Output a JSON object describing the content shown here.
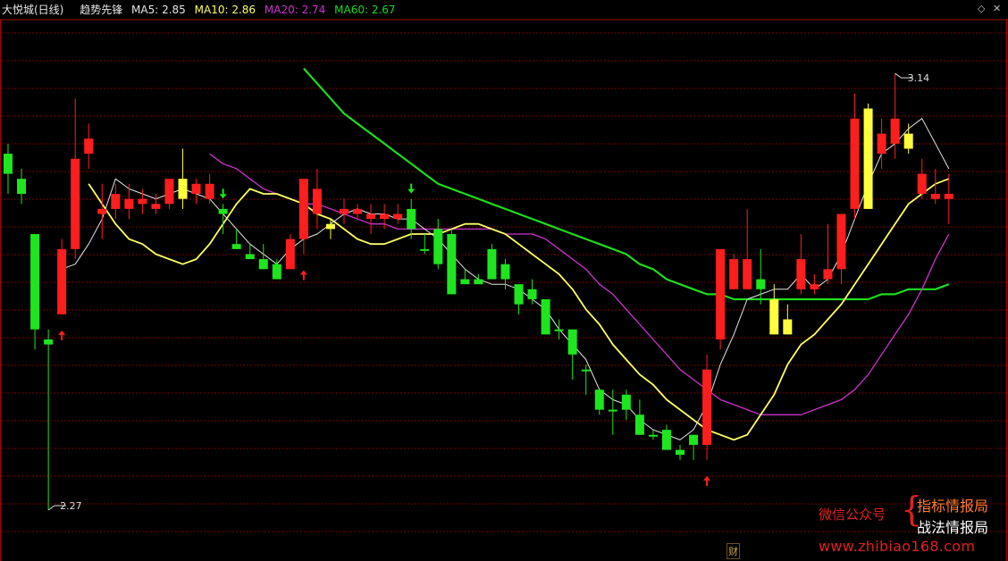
{
  "header": {
    "title": "大悦城(日线)",
    "indicator": "趋势先锋",
    "ma5": "MA5: 2.85",
    "ma10": "MA10: 2.86",
    "ma20": "MA20: 2.74",
    "ma60": "MA60: 2.67"
  },
  "controls": {
    "settings_icon": "diamond-icon",
    "close_icon": "close-icon"
  },
  "watermark": {
    "left": "微信公众号",
    "right_top": "指标情报局",
    "right_bottom": "战法情报局",
    "url": "www.zhibiao168.com"
  },
  "footer_badge": "财",
  "colors": {
    "up": "#ff1e1e",
    "down": "#1ee61e",
    "special": "#ffff3c",
    "ma5": "#e6e6e6",
    "ma10": "#ffff66",
    "ma20": "#cc33cc",
    "ma60": "#1edc1e",
    "grid": "#7a0000"
  },
  "chart_data": {
    "type": "candlestick",
    "title": "大悦城(日线)",
    "ylim": [
      2.222,
      3.272
    ],
    "annotations": {
      "high_label": "3.14",
      "low_label": "2.27"
    },
    "candles": [
      [
        2.98,
        2.94,
        3.0,
        2.9,
        "down"
      ],
      [
        2.93,
        2.9,
        2.95,
        2.88,
        "down"
      ],
      [
        2.82,
        2.63,
        2.82,
        2.59,
        "down"
      ],
      [
        2.61,
        2.6,
        2.63,
        2.27,
        "down"
      ],
      [
        2.66,
        2.79,
        2.81,
        2.66,
        "up"
      ],
      [
        2.79,
        2.97,
        3.09,
        2.77,
        "up"
      ],
      [
        2.98,
        3.01,
        3.04,
        2.95,
        "up"
      ],
      [
        2.87,
        2.86,
        2.92,
        2.81,
        "up"
      ],
      [
        2.87,
        2.9,
        2.92,
        2.85,
        "up"
      ],
      [
        2.87,
        2.89,
        2.92,
        2.85,
        "up"
      ],
      [
        2.88,
        2.89,
        2.91,
        2.86,
        "up"
      ],
      [
        2.88,
        2.87,
        2.9,
        2.86,
        "up"
      ],
      [
        2.88,
        2.93,
        2.93,
        2.87,
        "up"
      ],
      [
        2.89,
        2.93,
        2.99,
        2.87,
        "special"
      ],
      [
        2.9,
        2.92,
        2.93,
        2.88,
        "up"
      ],
      [
        2.89,
        2.92,
        2.94,
        2.88,
        "up"
      ],
      [
        2.86,
        2.87,
        2.88,
        2.82,
        "down"
      ],
      [
        2.8,
        2.79,
        2.83,
        2.79,
        "down"
      ],
      [
        2.78,
        2.77,
        2.8,
        2.77,
        "down"
      ],
      [
        2.77,
        2.75,
        2.8,
        2.75,
        "down"
      ],
      [
        2.76,
        2.73,
        2.77,
        2.73,
        "down"
      ],
      [
        2.75,
        2.81,
        2.82,
        2.75,
        "up"
      ],
      [
        2.81,
        2.93,
        2.93,
        2.78,
        "up"
      ],
      [
        2.86,
        2.91,
        2.95,
        2.83,
        "up"
      ],
      [
        2.83,
        2.84,
        2.85,
        2.81,
        "special"
      ],
      [
        2.86,
        2.87,
        2.89,
        2.84,
        "up"
      ],
      [
        2.87,
        2.86,
        2.88,
        2.85,
        "up"
      ],
      [
        2.85,
        2.86,
        2.88,
        2.82,
        "up"
      ],
      [
        2.85,
        2.86,
        2.88,
        2.83,
        "up"
      ],
      [
        2.86,
        2.85,
        2.88,
        2.84,
        "up"
      ],
      [
        2.87,
        2.83,
        2.89,
        2.81,
        "down"
      ],
      [
        2.79,
        2.79,
        2.82,
        2.78,
        "down"
      ],
      [
        2.83,
        2.76,
        2.85,
        2.75,
        "down"
      ],
      [
        2.82,
        2.7,
        2.83,
        2.7,
        "down"
      ],
      [
        2.73,
        2.72,
        2.75,
        2.72,
        "down"
      ],
      [
        2.73,
        2.72,
        2.74,
        2.72,
        "down"
      ],
      [
        2.79,
        2.73,
        2.8,
        2.73,
        "down"
      ],
      [
        2.76,
        2.73,
        2.77,
        2.71,
        "down"
      ],
      [
        2.72,
        2.68,
        2.72,
        2.66,
        "down"
      ],
      [
        2.71,
        2.69,
        2.73,
        2.68,
        "down"
      ],
      [
        2.69,
        2.62,
        2.69,
        2.62,
        "down"
      ],
      [
        2.63,
        2.63,
        2.65,
        2.61,
        "down"
      ],
      [
        2.63,
        2.58,
        2.63,
        2.53,
        "down"
      ],
      [
        2.55,
        2.55,
        2.56,
        2.5,
        "down"
      ],
      [
        2.51,
        2.47,
        2.51,
        2.46,
        "down"
      ],
      [
        2.47,
        2.47,
        2.51,
        2.42,
        "down"
      ],
      [
        2.5,
        2.47,
        2.51,
        2.45,
        "down"
      ],
      [
        2.46,
        2.42,
        2.49,
        2.42,
        "down"
      ],
      [
        2.42,
        2.42,
        2.43,
        2.41,
        "down"
      ],
      [
        2.43,
        2.39,
        2.44,
        2.39,
        "down"
      ],
      [
        2.39,
        2.38,
        2.4,
        2.37,
        "down"
      ],
      [
        2.42,
        2.4,
        2.42,
        2.37,
        "down"
      ],
      [
        2.4,
        2.55,
        2.58,
        2.37,
        "up"
      ],
      [
        2.61,
        2.79,
        2.79,
        2.59,
        "up"
      ],
      [
        2.71,
        2.77,
        2.78,
        2.71,
        "up"
      ],
      [
        2.71,
        2.77,
        2.87,
        2.71,
        "up"
      ],
      [
        2.73,
        2.71,
        2.79,
        2.68,
        "down"
      ],
      [
        2.69,
        2.62,
        2.72,
        2.62,
        "special"
      ],
      [
        2.62,
        2.65,
        2.68,
        2.62,
        "special"
      ],
      [
        2.71,
        2.77,
        2.82,
        2.7,
        "up"
      ],
      [
        2.71,
        2.72,
        2.74,
        2.7,
        "up"
      ],
      [
        2.73,
        2.75,
        2.84,
        2.72,
        "up"
      ],
      [
        2.75,
        2.86,
        2.86,
        2.72,
        "up"
      ],
      [
        2.87,
        3.05,
        3.1,
        2.85,
        "up"
      ],
      [
        2.87,
        3.07,
        3.08,
        2.87,
        "special"
      ],
      [
        2.98,
        3.02,
        3.05,
        2.95,
        "up"
      ],
      [
        3.0,
        3.05,
        3.14,
        2.97,
        "up"
      ],
      [
        3.02,
        2.99,
        3.04,
        2.98,
        "special"
      ],
      [
        2.94,
        2.9,
        2.97,
        2.89,
        "up"
      ],
      [
        2.89,
        2.9,
        2.95,
        2.88,
        "up"
      ],
      [
        2.89,
        2.9,
        2.94,
        2.84,
        "up"
      ]
    ],
    "ma5": [
      null,
      null,
      null,
      null,
      2.75,
      2.76,
      2.8,
      2.85,
      2.93,
      2.91,
      2.9,
      2.89,
      2.9,
      2.91,
      2.9,
      2.89,
      2.86,
      2.83,
      2.8,
      2.78,
      2.76,
      2.79,
      2.81,
      2.82,
      2.84,
      2.86,
      2.87,
      2.86,
      2.86,
      2.85,
      2.85,
      2.83,
      2.81,
      2.78,
      2.75,
      2.73,
      2.72,
      2.72,
      2.71,
      2.69,
      2.67,
      2.63,
      2.6,
      2.57,
      2.51,
      2.49,
      2.48,
      2.45,
      2.43,
      2.42,
      2.41,
      2.43,
      2.48,
      2.56,
      2.62,
      2.69,
      2.7,
      2.71,
      2.71,
      2.74,
      2.71,
      2.73,
      2.78,
      2.85,
      2.92,
      2.98,
      3.0,
      3.03,
      3.05,
      3.0,
      2.95
    ],
    "ma10": [
      2.92,
      2.88,
      2.84,
      2.81,
      2.8,
      2.78,
      2.77,
      2.76,
      2.77,
      2.8,
      2.84,
      2.88,
      2.91,
      2.9,
      2.9,
      2.89,
      2.88,
      2.86,
      2.85,
      2.83,
      2.81,
      2.8,
      2.8,
      2.81,
      2.82,
      2.82,
      2.82,
      2.83,
      2.84,
      2.84,
      2.83,
      2.82,
      2.8,
      2.78,
      2.76,
      2.74,
      2.71,
      2.67,
      2.64,
      2.6,
      2.57,
      2.54,
      2.52,
      2.49,
      2.47,
      2.45,
      2.43,
      2.42,
      2.41,
      2.42,
      2.46,
      2.5,
      2.56,
      2.6,
      2.62,
      2.65,
      2.68,
      2.72,
      2.76,
      2.8,
      2.84,
      2.88,
      2.9,
      2.92,
      2.93
    ],
    "ma20": [
      2.98,
      2.96,
      2.95,
      2.93,
      2.91,
      2.9,
      2.89,
      2.88,
      2.88,
      2.87,
      2.86,
      2.85,
      2.84,
      2.84,
      2.83,
      2.83,
      2.83,
      2.83,
      2.83,
      2.83,
      2.83,
      2.83,
      2.82,
      2.82,
      2.82,
      2.81,
      2.79,
      2.77,
      2.75,
      2.72,
      2.7,
      2.67,
      2.64,
      2.61,
      2.58,
      2.55,
      2.53,
      2.51,
      2.49,
      2.48,
      2.47,
      2.46,
      2.46,
      2.46,
      2.46,
      2.47,
      2.48,
      2.49,
      2.51,
      2.54,
      2.58,
      2.62,
      2.66,
      2.71,
      2.77,
      2.82
    ],
    "ma60": [
      3.15,
      3.12,
      3.09,
      3.06,
      3.04,
      3.02,
      3.0,
      2.98,
      2.96,
      2.94,
      2.92,
      2.91,
      2.9,
      2.89,
      2.88,
      2.87,
      2.86,
      2.85,
      2.84,
      2.83,
      2.82,
      2.81,
      2.8,
      2.79,
      2.78,
      2.76,
      2.75,
      2.73,
      2.72,
      2.71,
      2.7,
      2.7,
      2.69,
      2.69,
      2.69,
      2.69,
      2.69,
      2.69,
      2.69,
      2.69,
      2.69,
      2.69,
      2.69,
      2.7,
      2.7,
      2.71,
      2.71,
      2.71,
      2.72
    ],
    "signals": [
      {
        "index": 4,
        "type": "buy"
      },
      {
        "index": 16,
        "type": "sell"
      },
      {
        "index": 22,
        "type": "buy"
      },
      {
        "index": 30,
        "type": "sell"
      },
      {
        "index": 52,
        "type": "buy"
      }
    ]
  }
}
